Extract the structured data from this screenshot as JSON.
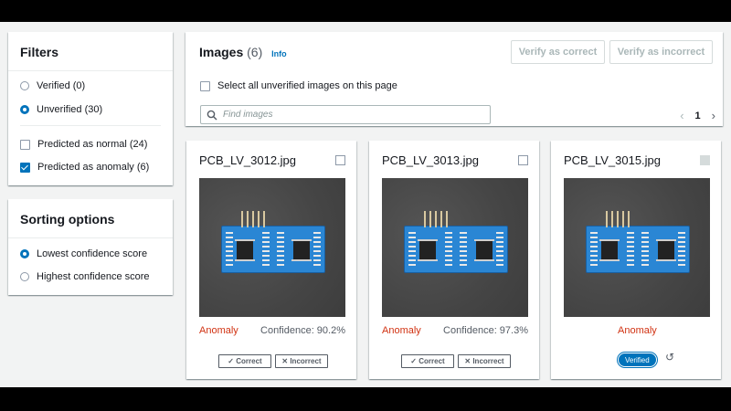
{
  "filters": {
    "title": "Filters",
    "verified": "Verified (0)",
    "unverified": "Unverified (30)",
    "predicted_normal": "Predicted as normal (24)",
    "predicted_anomaly": "Predicted as anomaly (6)"
  },
  "sorting": {
    "title": "Sorting options",
    "lowest": "Lowest confidence score",
    "highest": "Highest confidence score"
  },
  "images": {
    "title": "Images",
    "count": "(6)",
    "info": "Info",
    "verify_correct": "Verify as correct",
    "verify_incorrect": "Verify as incorrect",
    "select_all": "Select all unverified images on this page",
    "search_placeholder": "Find images",
    "page": "1"
  },
  "cards": [
    {
      "filename": "PCB_LV_3012.jpg",
      "label": "Anomaly",
      "confidence": "Confidence: 90.2%",
      "correct": "✓ Correct",
      "incorrect": "✕ Incorrect"
    },
    {
      "filename": "PCB_LV_3013.jpg",
      "label": "Anomaly",
      "confidence": "Confidence: 97.3%",
      "correct": "✓ Correct",
      "incorrect": "✕ Incorrect"
    },
    {
      "filename": "PCB_LV_3015.jpg",
      "label": "Anomaly",
      "status": "Verified"
    }
  ],
  "colors": {
    "accent": "#0073bb",
    "anomaly": "#d13212"
  }
}
